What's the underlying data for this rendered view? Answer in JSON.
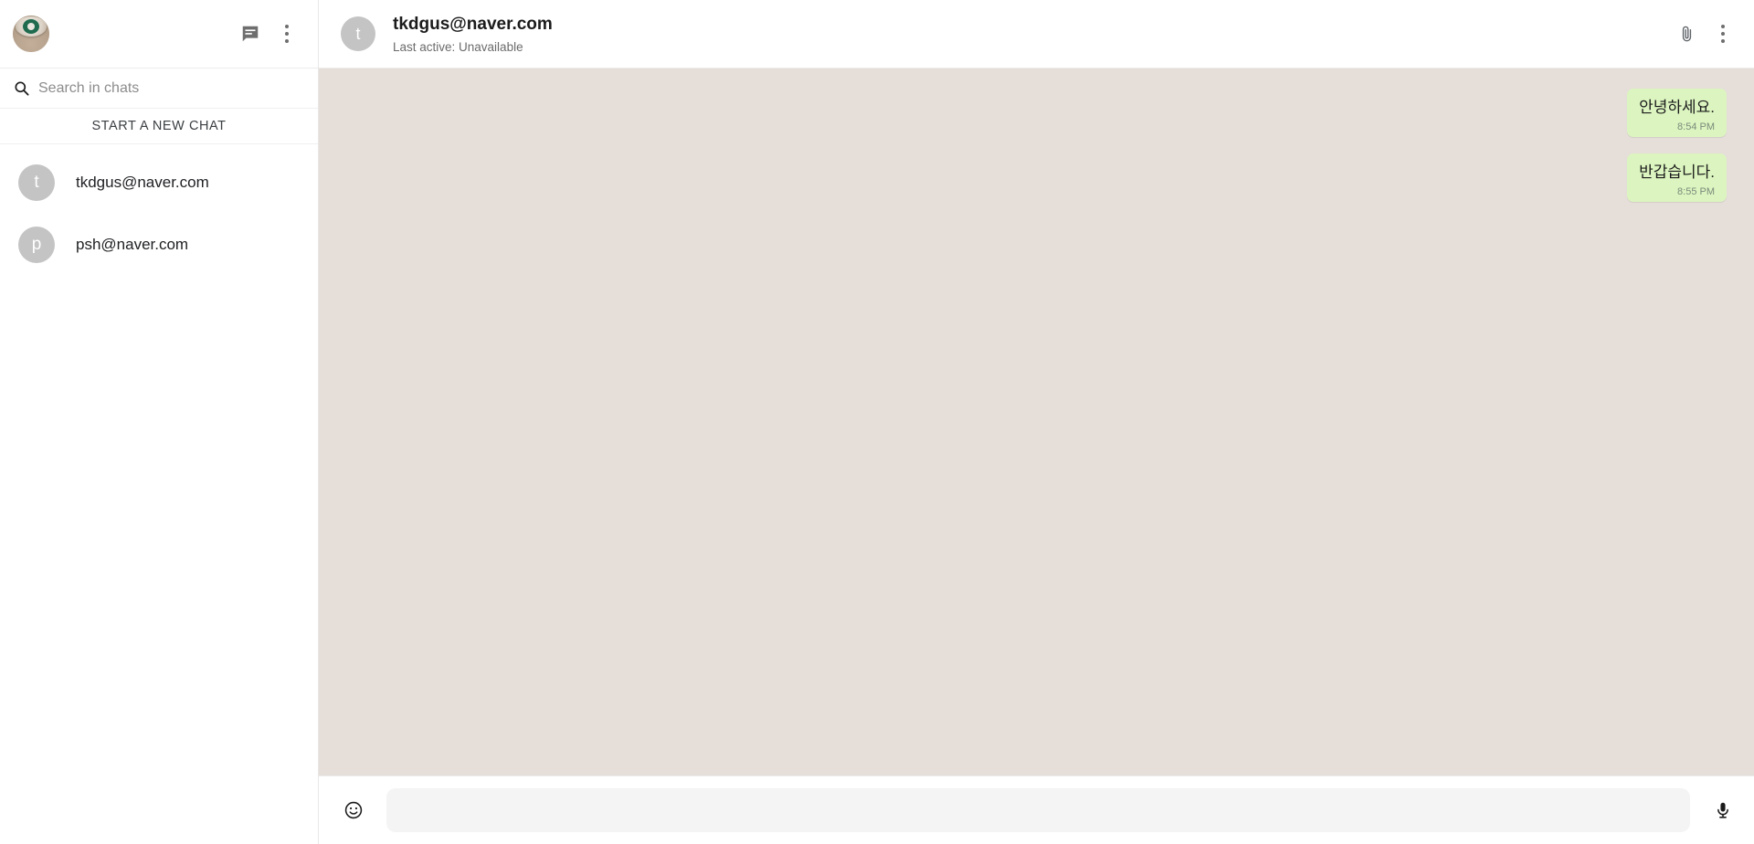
{
  "sidebar": {
    "profile": {
      "avatar_name": "profile-photo-coffee-cup",
      "alt": "Starbucks coffee cup"
    },
    "actions": [
      {
        "icon": "new-chat-icon",
        "label": "New chat"
      },
      {
        "icon": "more-options-icon",
        "label": "More options"
      }
    ],
    "search": {
      "placeholder": "Search in chats",
      "value": "",
      "icon": "search-icon"
    },
    "new_chat_button": {
      "label": "START A NEW CHAT"
    },
    "chats": [
      {
        "initial": "t",
        "name": "tkdgus@naver.com"
      },
      {
        "initial": "p",
        "name": "psh@naver.com"
      }
    ]
  },
  "header": {
    "avatar_initial": "t",
    "title": "tkdgus@naver.com",
    "subtitle": "Last active: Unavailable",
    "actions": [
      {
        "icon": "attachment-icon",
        "label": "Attach file"
      },
      {
        "icon": "more-options-icon",
        "label": "More options"
      }
    ]
  },
  "conversation": {
    "messages": [
      {
        "text": "안녕하세요.",
        "time": "8:54 PM",
        "direction": "outgoing"
      },
      {
        "text": "반갑습니다.",
        "time": "8:55 PM",
        "direction": "outgoing"
      }
    ]
  },
  "composer": {
    "emoji_icon": "emoji-smiley-icon",
    "placeholder": "",
    "value": "",
    "mic_icon": "microphone-icon"
  },
  "colors": {
    "chat_background": "#e5ded9",
    "bubble_outgoing": "#dcf5c0",
    "panel_background": "#ffffff",
    "avatar_placeholder": "#c4c4c4",
    "icon_gray": "#6e6e6e"
  }
}
